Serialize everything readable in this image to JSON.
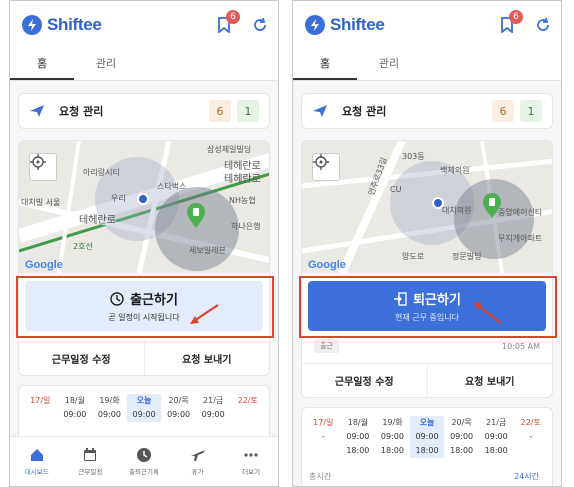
{
  "brand": {
    "name": "Shiftee",
    "accent": "#3a6fd8"
  },
  "left": {
    "badge_count": "6",
    "tabs": [
      {
        "label": "홈",
        "active": true
      },
      {
        "label": "관리",
        "active": false
      }
    ],
    "request": {
      "label": "요청 관리",
      "count_orange": "6",
      "count_green": "1"
    },
    "map": {
      "labels": {
        "samsung": "삼성제일빌딩",
        "teheran1": "테헤란로",
        "teheran2": "테헤란로",
        "arirang": "아리랑시티",
        "starbucks": "스타벅스",
        "woori": "우리",
        "daechi": "대치빌 서울",
        "teheran3": "테헤란로",
        "station": "2호선",
        "nonghyup": "NH농협",
        "hana": "하나은행",
        "seil": "세보일레븐"
      },
      "google": "Google"
    },
    "commute": {
      "title": "출근하기",
      "sub": "곧 일정이 시작됩니다"
    },
    "actions": [
      "근무일정 수정",
      "요청 보내기"
    ],
    "schedule": [
      {
        "label": "17/일",
        "time1": "",
        "time2": "",
        "kind": "sun"
      },
      {
        "label": "18/월",
        "time1": "09:00",
        "time2": "",
        "kind": ""
      },
      {
        "label": "19/화",
        "time1": "09:00",
        "time2": "",
        "kind": ""
      },
      {
        "label": "오늘",
        "time1": "09:00",
        "time2": "",
        "kind": "today"
      },
      {
        "label": "20/목",
        "time1": "09:00",
        "time2": "",
        "kind": ""
      },
      {
        "label": "21/금",
        "time1": "09:00",
        "time2": "",
        "kind": ""
      },
      {
        "label": "22/토",
        "time1": "",
        "time2": "",
        "kind": "sat"
      }
    ],
    "nav": [
      "대시보드",
      "근무일정",
      "출퇴근기록",
      "휴가",
      "더보기"
    ]
  },
  "right": {
    "badge_count": "6",
    "tabs": [
      {
        "label": "홈",
        "active": true
      },
      {
        "label": "관리",
        "active": false
      }
    ],
    "request": {
      "label": "요청 관리",
      "count_orange": "6",
      "count_green": "1"
    },
    "map": {
      "labels": {
        "b303": "303동",
        "baekje": "백제의원",
        "cu": "CU",
        "daechi": "대치의원",
        "junang": "중앙에이신티",
        "muji": "무지개아파트",
        "yangdo": "양도로",
        "jeongwon": "정문빌딩",
        "street": "언주로33길"
      },
      "google": "Google"
    },
    "commute": {
      "title": "퇴근하기",
      "sub": "현재 근무 중입니다"
    },
    "status": {
      "tag": "출근",
      "time": "10:05 AM"
    },
    "actions": [
      "근무일정 수정",
      "요청 보내기"
    ],
    "schedule": [
      {
        "label": "17/일",
        "time1": "-",
        "time2": "",
        "kind": "sun"
      },
      {
        "label": "18/월",
        "time1": "09:00",
        "time2": "18:00",
        "kind": ""
      },
      {
        "label": "19/화",
        "time1": "09:00",
        "time2": "18:00",
        "kind": ""
      },
      {
        "label": "오늘",
        "time1": "09:00",
        "time2": "18:00",
        "kind": "today"
      },
      {
        "label": "20/목",
        "time1": "09:00",
        "time2": "18:00",
        "kind": ""
      },
      {
        "label": "21/금",
        "time1": "09:00",
        "time2": "18:00",
        "kind": ""
      },
      {
        "label": "22/토",
        "time1": "-",
        "time2": "",
        "kind": "sat"
      }
    ],
    "extra_left": "총시간",
    "extra_right": "24시간"
  }
}
